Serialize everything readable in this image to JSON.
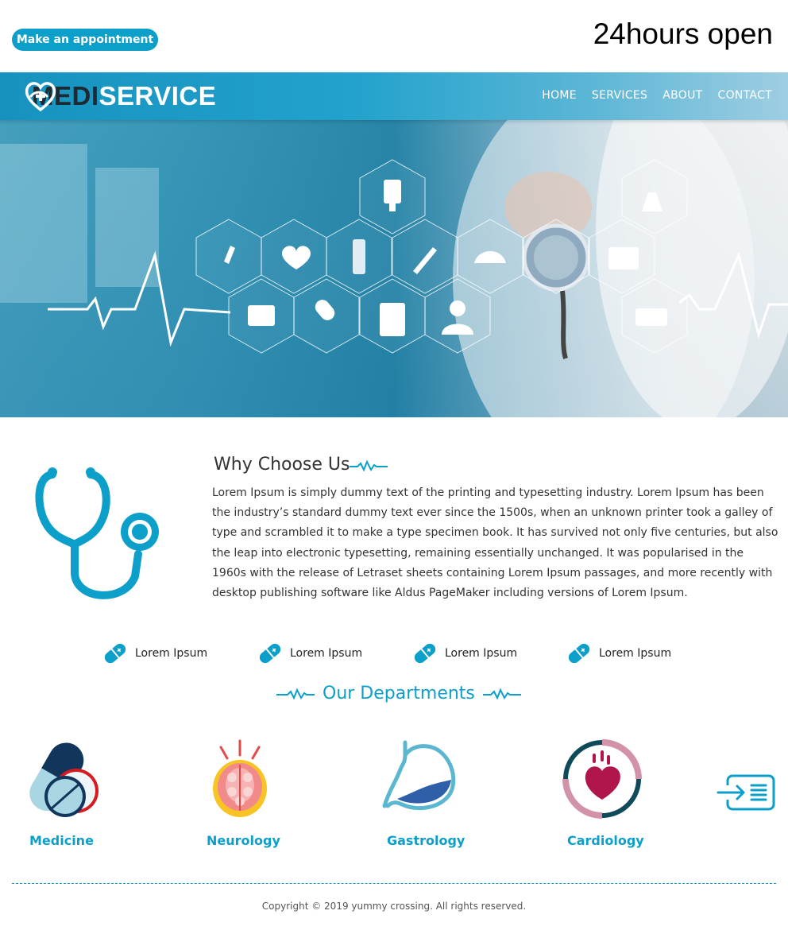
{
  "header": {
    "appointment_label": "Make an appointment",
    "hours_text": "24hours open"
  },
  "logo": {
    "part1": "MEDI",
    "part2": "SERVICE"
  },
  "nav": {
    "items": [
      "HOME",
      "SERVICES",
      "ABOUT",
      "CONTACT"
    ]
  },
  "why": {
    "title": "Why Choose Us",
    "body": "Lorem Ipsum is simply dummy text of the printing and typesetting industry. Lorem Ipsum has been the industry’s standard dummy text ever since the 1500s, when an unknown printer took a galley of type and scrambled it to make a type specimen book. It has survived not only five centuries, but also the leap into electronic typesetting, remaining essentially unchanged. It was popularised in the 1960s with the release of Letraset sheets containing Lorem Ipsum passages, and more recently with desktop publishing software like Aldus PageMaker including versions of Lorem Ipsum."
  },
  "features": [
    "Lorem Ipsum",
    "Lorem Ipsum",
    "Lorem Ipsum",
    "Lorem Ipsum"
  ],
  "departments": {
    "title": "Our Departments",
    "items": [
      {
        "label": "Medicine",
        "icon": "pills-icon"
      },
      {
        "label": "Neurology",
        "icon": "brain-icon"
      },
      {
        "label": "Gastrology",
        "icon": "stomach-icon"
      },
      {
        "label": "Cardiology",
        "icon": "heart-icon"
      }
    ],
    "next_icon": "arrow-list-icon"
  },
  "footer": {
    "copyright": "Copyright © 2019 yummy crossing. All rights reserved."
  },
  "colors": {
    "accent": "#0c9fca",
    "logo_dark": "#1e2a33"
  }
}
